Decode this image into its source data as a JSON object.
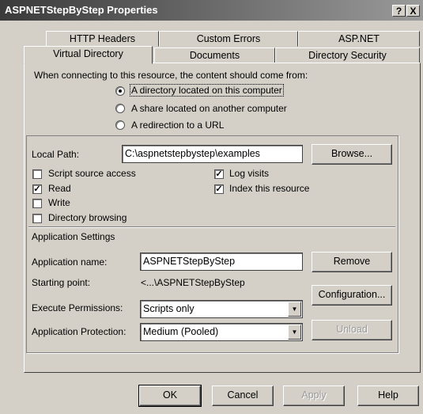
{
  "window": {
    "title": "ASPNETStepByStep Properties",
    "help_button": "?",
    "close_button": "X"
  },
  "tabs": {
    "back": [
      "HTTP Headers",
      "Custom Errors",
      "ASP.NET"
    ],
    "front": [
      "Virtual Directory",
      "Documents",
      "Directory Security"
    ],
    "selected": "Virtual Directory"
  },
  "content_source": {
    "prompt": "When connecting to this resource, the content should come from:",
    "options": [
      {
        "label": "A directory located on this computer",
        "selected": true
      },
      {
        "label": "A share located on another computer",
        "selected": false
      },
      {
        "label": "A redirection to a URL",
        "selected": false
      }
    ]
  },
  "local_path": {
    "label": "Local Path:",
    "value": "C:\\aspnetstepbystep\\examples",
    "browse_label": "Browse..."
  },
  "permissions_left": [
    {
      "label": "Script source access",
      "checked": false
    },
    {
      "label": "Read",
      "checked": true
    },
    {
      "label": "Write",
      "checked": false
    },
    {
      "label": "Directory browsing",
      "checked": false
    }
  ],
  "permissions_right": [
    {
      "label": "Log visits",
      "checked": true
    },
    {
      "label": "Index this resource",
      "checked": true
    }
  ],
  "app_settings": {
    "section_title": "Application Settings",
    "name_label": "Application name:",
    "name_value": "ASPNETStepByStep",
    "remove_label": "Remove",
    "start_label": "Starting point:",
    "start_value": "<...\\ASPNETStepByStep",
    "configuration_label": "Configuration...",
    "exec_label": "Execute Permissions:",
    "exec_value": "Scripts only",
    "protection_label": "Application Protection:",
    "protection_value": "Medium (Pooled)",
    "unload_label": "Unload"
  },
  "footer": {
    "ok": "OK",
    "cancel": "Cancel",
    "apply": "Apply",
    "help": "Help"
  },
  "check_glyph": "✓",
  "combo_arrow_glyph": "▼"
}
